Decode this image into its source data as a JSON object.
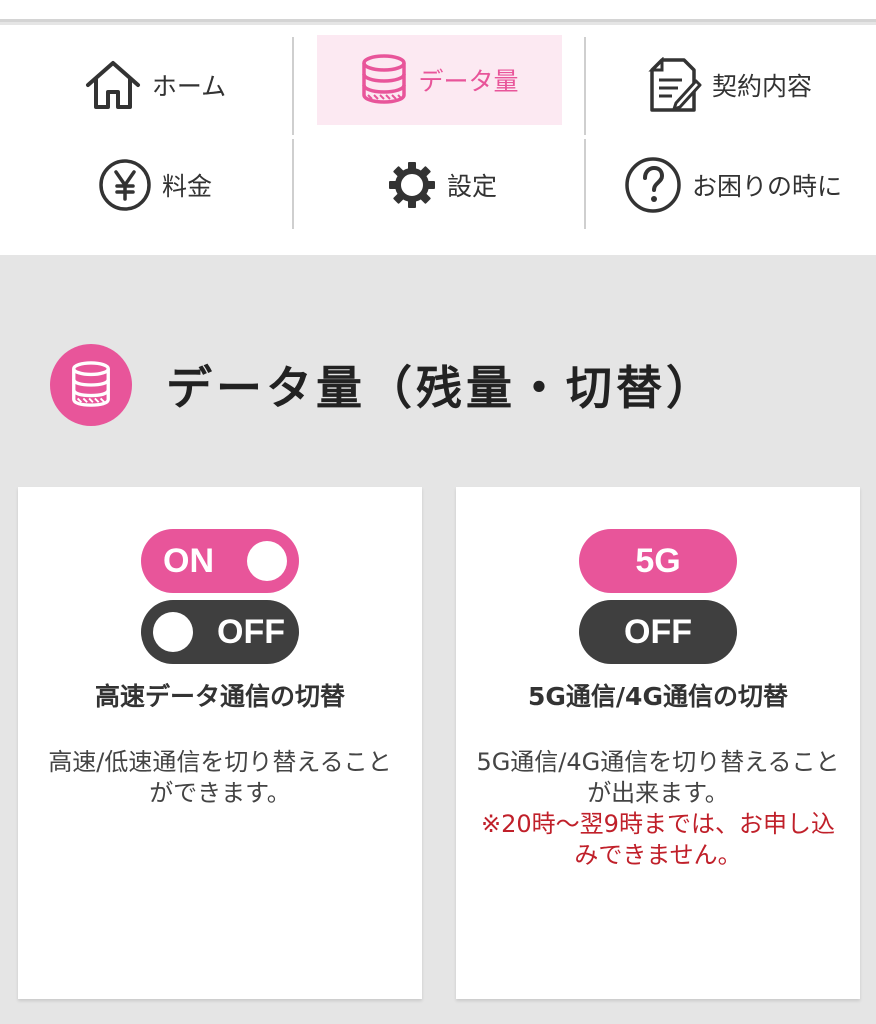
{
  "nav": {
    "home": "ホーム",
    "data": "データ量",
    "contract": "契約内容",
    "fee": "料金",
    "settings": "設定",
    "help": "お困りの時に"
  },
  "section": {
    "title": "データ量（残量・切替）"
  },
  "cards": {
    "speed": {
      "on_label": "ON",
      "off_label": "OFF",
      "title": "高速データ通信の切替",
      "desc": "高速/低速通信を切り替えることができます。"
    },
    "fiveg": {
      "badge": "5G",
      "off_label": "OFF",
      "title": "5G通信/4G通信の切替",
      "desc": "5G通信/4G通信を切り替えることが出来ます。",
      "note": "※20時～翌9時までは、お申し込みできません。"
    }
  },
  "colors": {
    "accent": "#e8559a",
    "accent_light": "#fce9f2",
    "dark_pill": "#3f3f3f",
    "note_red": "#c0202a"
  }
}
